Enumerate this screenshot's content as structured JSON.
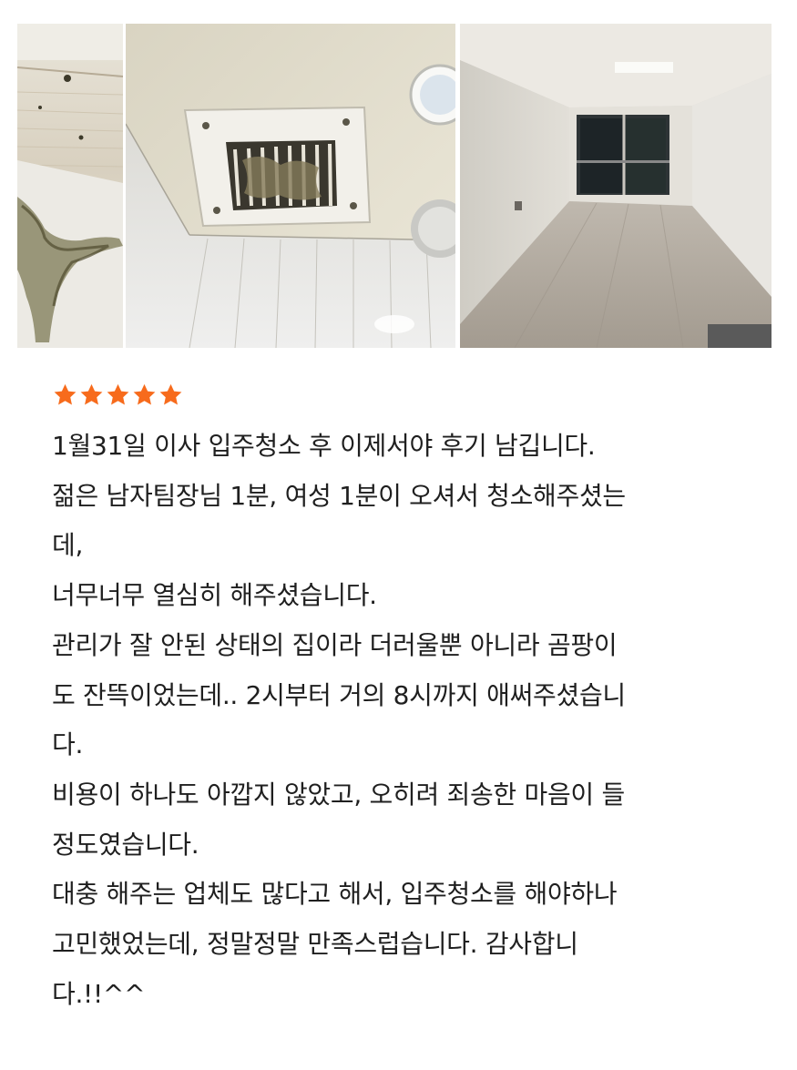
{
  "review": {
    "rating": 5,
    "star_color": "#f76b1c",
    "photos": [
      {
        "name": "wall-mold-photo"
      },
      {
        "name": "bathroom-vent-photo"
      },
      {
        "name": "empty-room-photo"
      }
    ],
    "lines": [
      "1월31일 이사 입주청소 후 이제서야 후기 남깁니다.",
      "젊은 남자팀장님 1분, 여성 1분이 오셔서 청소해주셨는",
      "데,",
      "너무너무 열심히 해주셨습니다.",
      "관리가 잘 안된 상태의 집이라 더러울뿐 아니라 곰팡이",
      "도 잔뜩이었는데.. 2시부터 거의 8시까지 애써주셨습니",
      "다.",
      "비용이 하나도 아깝지 않았고, 오히려 죄송한 마음이 들",
      "정도였습니다.",
      "대충 해주는 업체도 많다고 해서, 입주청소를 해야하나",
      "고민했었는데, 정말정말 만족스럽습니다. 감사합니",
      "다.!!^^"
    ]
  }
}
